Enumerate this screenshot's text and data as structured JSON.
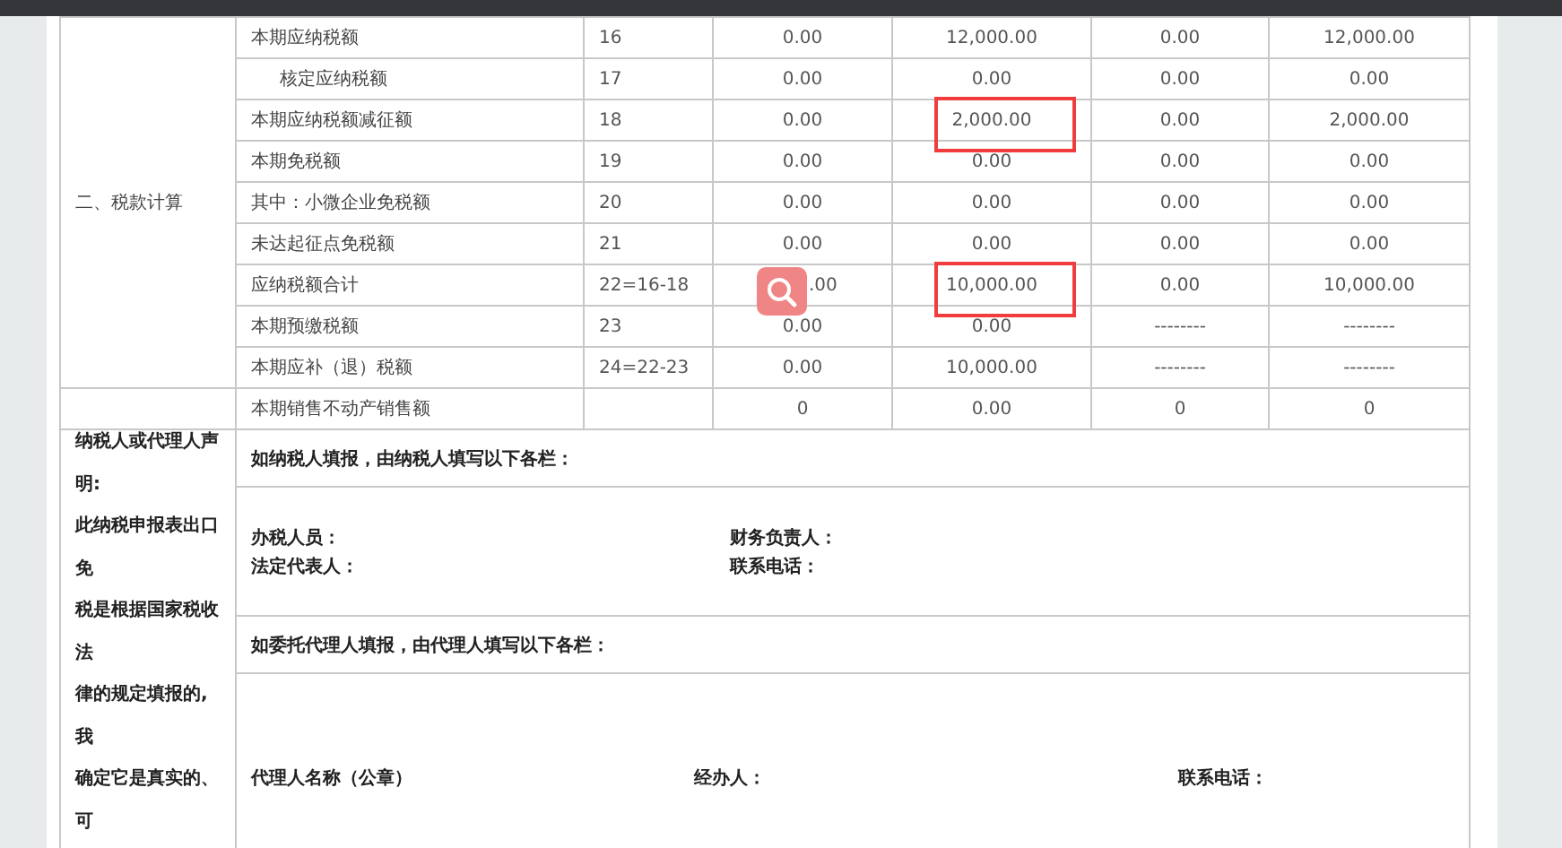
{
  "tax_table": {
    "section_label": "二、税款计算",
    "rows": [
      {
        "label": "本期应纳税额",
        "indented": false,
        "line": "16",
        "values": [
          {
            "text": "0.00",
            "marked": false
          },
          {
            "text": "12,000.00",
            "marked": false
          },
          {
            "text": "0.00",
            "marked": false
          },
          {
            "text": "12,000.00",
            "marked": false
          }
        ]
      },
      {
        "label": "核定应纳税额",
        "indented": true,
        "line": "17",
        "values": [
          {
            "text": "0.00",
            "marked": false
          },
          {
            "text": "0.00",
            "marked": false
          },
          {
            "text": "0.00",
            "marked": false
          },
          {
            "text": "0.00",
            "marked": false
          }
        ]
      },
      {
        "label": "本期应纳税额减征额",
        "indented": false,
        "line": "18",
        "values": [
          {
            "text": "0.00",
            "marked": false
          },
          {
            "text": "2,000.00",
            "marked": true
          },
          {
            "text": "0.00",
            "marked": false
          },
          {
            "text": "2,000.00",
            "marked": false
          }
        ]
      },
      {
        "label": "本期免税额",
        "indented": false,
        "line": "19",
        "values": [
          {
            "text": "0.00",
            "marked": false
          },
          {
            "text": "0.00",
            "marked": false
          },
          {
            "text": "0.00",
            "marked": false
          },
          {
            "text": "0.00",
            "marked": false
          }
        ]
      },
      {
        "label": "其中：小微企业免税额",
        "indented": false,
        "line": "20",
        "values": [
          {
            "text": "0.00",
            "marked": false
          },
          {
            "text": "0.00",
            "marked": false
          },
          {
            "text": "0.00",
            "marked": false
          },
          {
            "text": "0.00",
            "marked": false
          }
        ]
      },
      {
        "label": "未达起征点免税额",
        "indented": false,
        "line": "21",
        "values": [
          {
            "text": "0.00",
            "marked": false
          },
          {
            "text": "0.00",
            "marked": false
          },
          {
            "text": "0.00",
            "marked": false
          },
          {
            "text": "0.00",
            "marked": false
          }
        ]
      },
      {
        "label": "应纳税额合计",
        "indented": false,
        "line": "22=16-18",
        "values": [
          {
            "text": ".00",
            "marked": false
          },
          {
            "text": "10,000.00",
            "marked": true
          },
          {
            "text": "0.00",
            "marked": false
          },
          {
            "text": "10,000.00",
            "marked": false
          }
        ]
      },
      {
        "label": "本期预缴税额",
        "indented": false,
        "line": "23",
        "values": [
          {
            "text": "0.00",
            "marked": false
          },
          {
            "text": "0.00",
            "marked": false
          },
          {
            "text": "--------",
            "marked": false
          },
          {
            "text": "--------",
            "marked": false
          }
        ]
      },
      {
        "label": "本期应补（退）税额",
        "indented": false,
        "line": "24=22-23",
        "values": [
          {
            "text": "0.00",
            "marked": false
          },
          {
            "text": "10,000.00",
            "marked": false
          },
          {
            "text": "--------",
            "marked": false
          },
          {
            "text": "--------",
            "marked": false
          }
        ]
      }
    ],
    "extra_row": {
      "label": "本期销售不动产销售额",
      "values": [
        "0",
        "0.00",
        "0",
        "0"
      ]
    }
  },
  "declaration": {
    "statement_lines": [
      "纳税人或代理人声",
      "明:",
      "此纳税申报表出口",
      "免",
      "税是根据国家税收",
      "法",
      "律的规定填报的,",
      "我",
      "确定它是真实的、",
      "可"
    ],
    "taxpayer_heading": "如纳税人填报，由纳税人填写以下各栏：",
    "taxpayer_fields": [
      "办税人员：",
      "财务负责人：",
      "法定代表人：",
      "联系电话："
    ],
    "agent_heading": "如委托代理人填报，由代理人填写以下各栏：",
    "agent_fields": [
      "代理人名称（公章）",
      "经办人：",
      "联系电话："
    ]
  }
}
